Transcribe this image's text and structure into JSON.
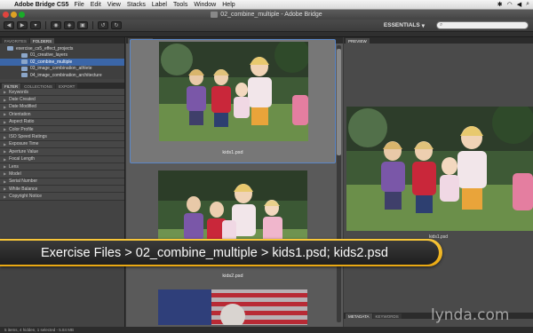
{
  "menubar": {
    "app_name": "Adobe Bridge CS5",
    "items": [
      "File",
      "Edit",
      "View",
      "Stacks",
      "Label",
      "Tools",
      "Window",
      "Help"
    ]
  },
  "window": {
    "title": "02_combine_multiple - Adobe Bridge"
  },
  "toolbar": {
    "workspace": "ESSENTIALS",
    "search_placeholder": ""
  },
  "left_panel": {
    "tabs": [
      "FAVORITES",
      "FOLDERS"
    ],
    "folders": [
      {
        "label": "exercise_cs5_effect_projects",
        "selected": false,
        "indent": false
      },
      {
        "label": "01_creative_layers",
        "selected": false,
        "indent": true
      },
      {
        "label": "02_combine_multiple",
        "selected": true,
        "indent": true
      },
      {
        "label": "03_image_combination_athlete",
        "selected": false,
        "indent": true
      },
      {
        "label": "04_image_combination_architecture",
        "selected": false,
        "indent": true
      }
    ],
    "filter_tabs": [
      "FILTER",
      "COLLECTIONS",
      "EXPORT"
    ],
    "filters": [
      "Keywords",
      "Date Created",
      "Date Modified",
      "Orientation",
      "Aspect Ratio",
      "Color Profile",
      "ISO Speed Ratings",
      "Exposure Time",
      "Aperture Value",
      "Focal Length",
      "Lens",
      "Model",
      "Serial Number",
      "White Balance",
      "Copyright Notice"
    ]
  },
  "content_panel": {
    "tab": "CONTENT",
    "thumbnails": [
      {
        "filename": "kids1.psd",
        "selected": true
      },
      {
        "filename": "kids2.psd",
        "selected": false
      }
    ]
  },
  "preview_panel": {
    "tab": "PREVIEW",
    "caption": "kids1.psd",
    "bottom_tabs": [
      "METADATA",
      "KEYWORDS"
    ]
  },
  "statusbar": {
    "text": "5 items, 4 hidden, 1 selected - 5.84 MB"
  },
  "overlay": {
    "text": "Exercise Files > 02_combine_multiple > kids1.psd; kids2.psd"
  },
  "watermark": {
    "text": "lynda.com"
  },
  "colors": {
    "selection": "#3b66a8",
    "banner_gold": "#f4b927",
    "banner_dark": "#2b2b2b"
  }
}
